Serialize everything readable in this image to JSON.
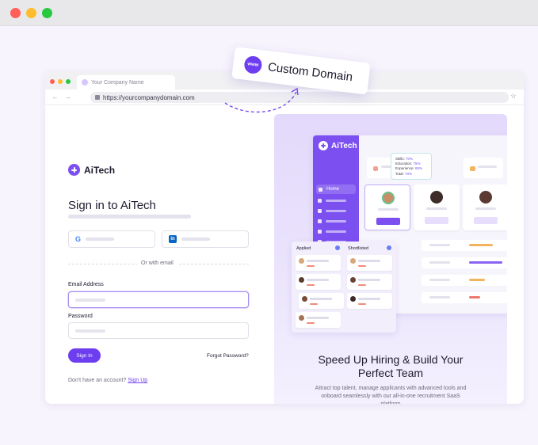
{
  "browser": {
    "tab_title": "Your Company Name",
    "url": "https://yourcompanydomain.com",
    "back_glyph": "←",
    "forward_glyph": "→",
    "star_glyph": "☆"
  },
  "badge": {
    "icon_text": "www",
    "label": "Custom Domain"
  },
  "signin": {
    "logo_text": "AiTech",
    "title": "Sign in to AiTech",
    "google_glyph": "G",
    "linkedin_glyph": "in",
    "divider_text": "Or with email",
    "email_label": "Email Address",
    "password_label": "Password",
    "signin_button": "Sign In",
    "forgot_link": "Forgot Password?",
    "no_account_text": "Don't have an account?",
    "signup_link": "Sign Up"
  },
  "promo": {
    "app_logo_text": "AiTech",
    "home_label": "Home",
    "tooltip": {
      "skills": "Skills: ",
      "skills_pct": "70%",
      "education": "Education: ",
      "education_pct": "75%",
      "experience": "Experience: ",
      "experience_pct": "65%",
      "total": "Total: ",
      "total_pct": "70%"
    },
    "kanban": {
      "col_a": "Applied",
      "col_b": "Shortlisted"
    },
    "title_line1": "Speed Up Hiring & Build Your",
    "title_line2": "Perfect Team",
    "subtitle": "Attract top talent, manage applicants with advanced tools and onboard seamlessly with our all-in-one recruitment SaaS platform"
  },
  "colors": {
    "brand": "#6d3df0",
    "sidebar": "#7b4ff0"
  }
}
